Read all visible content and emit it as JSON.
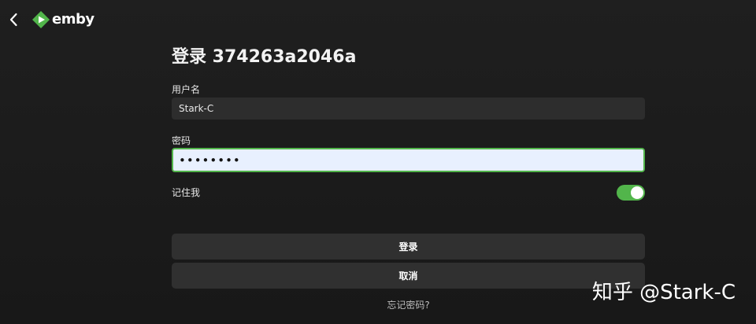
{
  "header": {
    "brand_name": "emby"
  },
  "login": {
    "title": "登录 374263a2046a",
    "username_label": "用户名",
    "username_value": "Stark-C",
    "password_label": "密码",
    "password_value": "••••••••",
    "remember_label": "记住我",
    "remember_enabled": true,
    "login_button": "登录",
    "cancel_button": "取消",
    "forgot_link": "忘记密码?"
  },
  "watermark": {
    "text": "知乎 @Stark-C"
  },
  "colors": {
    "accent": "#52b54b",
    "background": "#1c1c1c",
    "input_bg": "#2d2d2d",
    "button_bg": "#303030",
    "autofill_bg": "#e8f0fe"
  },
  "icons": {
    "back": "chevron-left-icon",
    "logo": "emby-logo-icon"
  }
}
